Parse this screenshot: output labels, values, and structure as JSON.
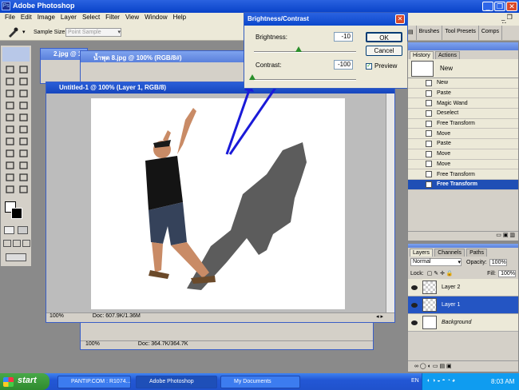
{
  "app": {
    "title": "Adobe Photoshop"
  },
  "menu": [
    "File",
    "Edit",
    "Image",
    "Layer",
    "Select",
    "Filter",
    "View",
    "Window",
    "Help"
  ],
  "options": {
    "sample_size_label": "Sample Size:",
    "sample_size_value": "Point Sample"
  },
  "palette_well": [
    "Brushes",
    "Tool Presets",
    "Comps"
  ],
  "windows": {
    "back1": {
      "title": "2.jpg @ 1"
    },
    "back2": {
      "title": "น้ำพุต 8.jpg @ 100% (RGB/8#)",
      "zoom": "100%",
      "doc": "Doc: 364.7K/364.7K"
    },
    "front": {
      "title": "Untitled-1 @ 100% (Layer 1, RGB/8)",
      "zoom": "100%",
      "doc": "Doc: 607.9K/1.36M"
    }
  },
  "dialog": {
    "title": "Brightness/Contrast",
    "brightness_label": "Brightness:",
    "brightness_value": "-10",
    "contrast_label": "Contrast:",
    "contrast_value": "-100",
    "ok": "OK",
    "cancel": "Cancel",
    "preview": "Preview",
    "preview_checked": true
  },
  "history": {
    "tabs": [
      "History",
      "Actions"
    ],
    "snapshot": "New",
    "items": [
      "New",
      "Paste",
      "Magic Wand",
      "Deselect",
      "Free Transform",
      "Move",
      "Paste",
      "Move",
      "Move",
      "Free Transform",
      "Free Transform"
    ],
    "selected_index": 10
  },
  "layers": {
    "tabs": [
      "Layers",
      "Channels",
      "Paths"
    ],
    "blend_mode": "Normal",
    "opacity_label": "Opacity:",
    "opacity": "100%",
    "lock_label": "Lock:",
    "fill_label": "Fill:",
    "fill": "100%",
    "items": [
      "Layer 2",
      "Layer 1",
      "Background"
    ],
    "selected_index": 1
  },
  "taskbar": {
    "start": "start",
    "tasks": [
      "PANTIP.COM : R1074...",
      "Adobe Photoshop",
      "My Documents"
    ],
    "lang": "EN",
    "time": "8:03 AM"
  },
  "colors": {
    "xp_blue": "#0842c8",
    "arrow": "#1a1ad8"
  }
}
